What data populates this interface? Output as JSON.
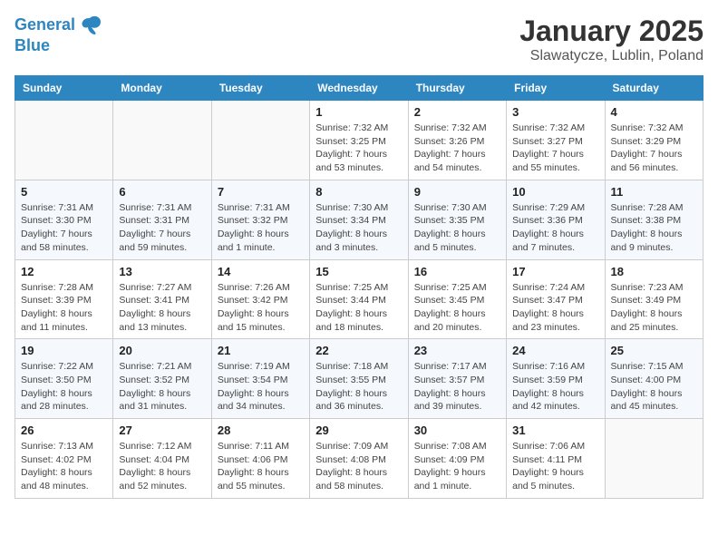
{
  "logo": {
    "line1": "General",
    "line2": "Blue"
  },
  "title": "January 2025",
  "subtitle": "Slawatycze, Lublin, Poland",
  "weekdays": [
    "Sunday",
    "Monday",
    "Tuesday",
    "Wednesday",
    "Thursday",
    "Friday",
    "Saturday"
  ],
  "weeks": [
    [
      {
        "day": "",
        "info": ""
      },
      {
        "day": "",
        "info": ""
      },
      {
        "day": "",
        "info": ""
      },
      {
        "day": "1",
        "info": "Sunrise: 7:32 AM\nSunset: 3:25 PM\nDaylight: 7 hours and 53 minutes."
      },
      {
        "day": "2",
        "info": "Sunrise: 7:32 AM\nSunset: 3:26 PM\nDaylight: 7 hours and 54 minutes."
      },
      {
        "day": "3",
        "info": "Sunrise: 7:32 AM\nSunset: 3:27 PM\nDaylight: 7 hours and 55 minutes."
      },
      {
        "day": "4",
        "info": "Sunrise: 7:32 AM\nSunset: 3:29 PM\nDaylight: 7 hours and 56 minutes."
      }
    ],
    [
      {
        "day": "5",
        "info": "Sunrise: 7:31 AM\nSunset: 3:30 PM\nDaylight: 7 hours and 58 minutes."
      },
      {
        "day": "6",
        "info": "Sunrise: 7:31 AM\nSunset: 3:31 PM\nDaylight: 7 hours and 59 minutes."
      },
      {
        "day": "7",
        "info": "Sunrise: 7:31 AM\nSunset: 3:32 PM\nDaylight: 8 hours and 1 minute."
      },
      {
        "day": "8",
        "info": "Sunrise: 7:30 AM\nSunset: 3:34 PM\nDaylight: 8 hours and 3 minutes."
      },
      {
        "day": "9",
        "info": "Sunrise: 7:30 AM\nSunset: 3:35 PM\nDaylight: 8 hours and 5 minutes."
      },
      {
        "day": "10",
        "info": "Sunrise: 7:29 AM\nSunset: 3:36 PM\nDaylight: 8 hours and 7 minutes."
      },
      {
        "day": "11",
        "info": "Sunrise: 7:28 AM\nSunset: 3:38 PM\nDaylight: 8 hours and 9 minutes."
      }
    ],
    [
      {
        "day": "12",
        "info": "Sunrise: 7:28 AM\nSunset: 3:39 PM\nDaylight: 8 hours and 11 minutes."
      },
      {
        "day": "13",
        "info": "Sunrise: 7:27 AM\nSunset: 3:41 PM\nDaylight: 8 hours and 13 minutes."
      },
      {
        "day": "14",
        "info": "Sunrise: 7:26 AM\nSunset: 3:42 PM\nDaylight: 8 hours and 15 minutes."
      },
      {
        "day": "15",
        "info": "Sunrise: 7:25 AM\nSunset: 3:44 PM\nDaylight: 8 hours and 18 minutes."
      },
      {
        "day": "16",
        "info": "Sunrise: 7:25 AM\nSunset: 3:45 PM\nDaylight: 8 hours and 20 minutes."
      },
      {
        "day": "17",
        "info": "Sunrise: 7:24 AM\nSunset: 3:47 PM\nDaylight: 8 hours and 23 minutes."
      },
      {
        "day": "18",
        "info": "Sunrise: 7:23 AM\nSunset: 3:49 PM\nDaylight: 8 hours and 25 minutes."
      }
    ],
    [
      {
        "day": "19",
        "info": "Sunrise: 7:22 AM\nSunset: 3:50 PM\nDaylight: 8 hours and 28 minutes."
      },
      {
        "day": "20",
        "info": "Sunrise: 7:21 AM\nSunset: 3:52 PM\nDaylight: 8 hours and 31 minutes."
      },
      {
        "day": "21",
        "info": "Sunrise: 7:19 AM\nSunset: 3:54 PM\nDaylight: 8 hours and 34 minutes."
      },
      {
        "day": "22",
        "info": "Sunrise: 7:18 AM\nSunset: 3:55 PM\nDaylight: 8 hours and 36 minutes."
      },
      {
        "day": "23",
        "info": "Sunrise: 7:17 AM\nSunset: 3:57 PM\nDaylight: 8 hours and 39 minutes."
      },
      {
        "day": "24",
        "info": "Sunrise: 7:16 AM\nSunset: 3:59 PM\nDaylight: 8 hours and 42 minutes."
      },
      {
        "day": "25",
        "info": "Sunrise: 7:15 AM\nSunset: 4:00 PM\nDaylight: 8 hours and 45 minutes."
      }
    ],
    [
      {
        "day": "26",
        "info": "Sunrise: 7:13 AM\nSunset: 4:02 PM\nDaylight: 8 hours and 48 minutes."
      },
      {
        "day": "27",
        "info": "Sunrise: 7:12 AM\nSunset: 4:04 PM\nDaylight: 8 hours and 52 minutes."
      },
      {
        "day": "28",
        "info": "Sunrise: 7:11 AM\nSunset: 4:06 PM\nDaylight: 8 hours and 55 minutes."
      },
      {
        "day": "29",
        "info": "Sunrise: 7:09 AM\nSunset: 4:08 PM\nDaylight: 8 hours and 58 minutes."
      },
      {
        "day": "30",
        "info": "Sunrise: 7:08 AM\nSunset: 4:09 PM\nDaylight: 9 hours and 1 minute."
      },
      {
        "day": "31",
        "info": "Sunrise: 7:06 AM\nSunset: 4:11 PM\nDaylight: 9 hours and 5 minutes."
      },
      {
        "day": "",
        "info": ""
      }
    ]
  ]
}
